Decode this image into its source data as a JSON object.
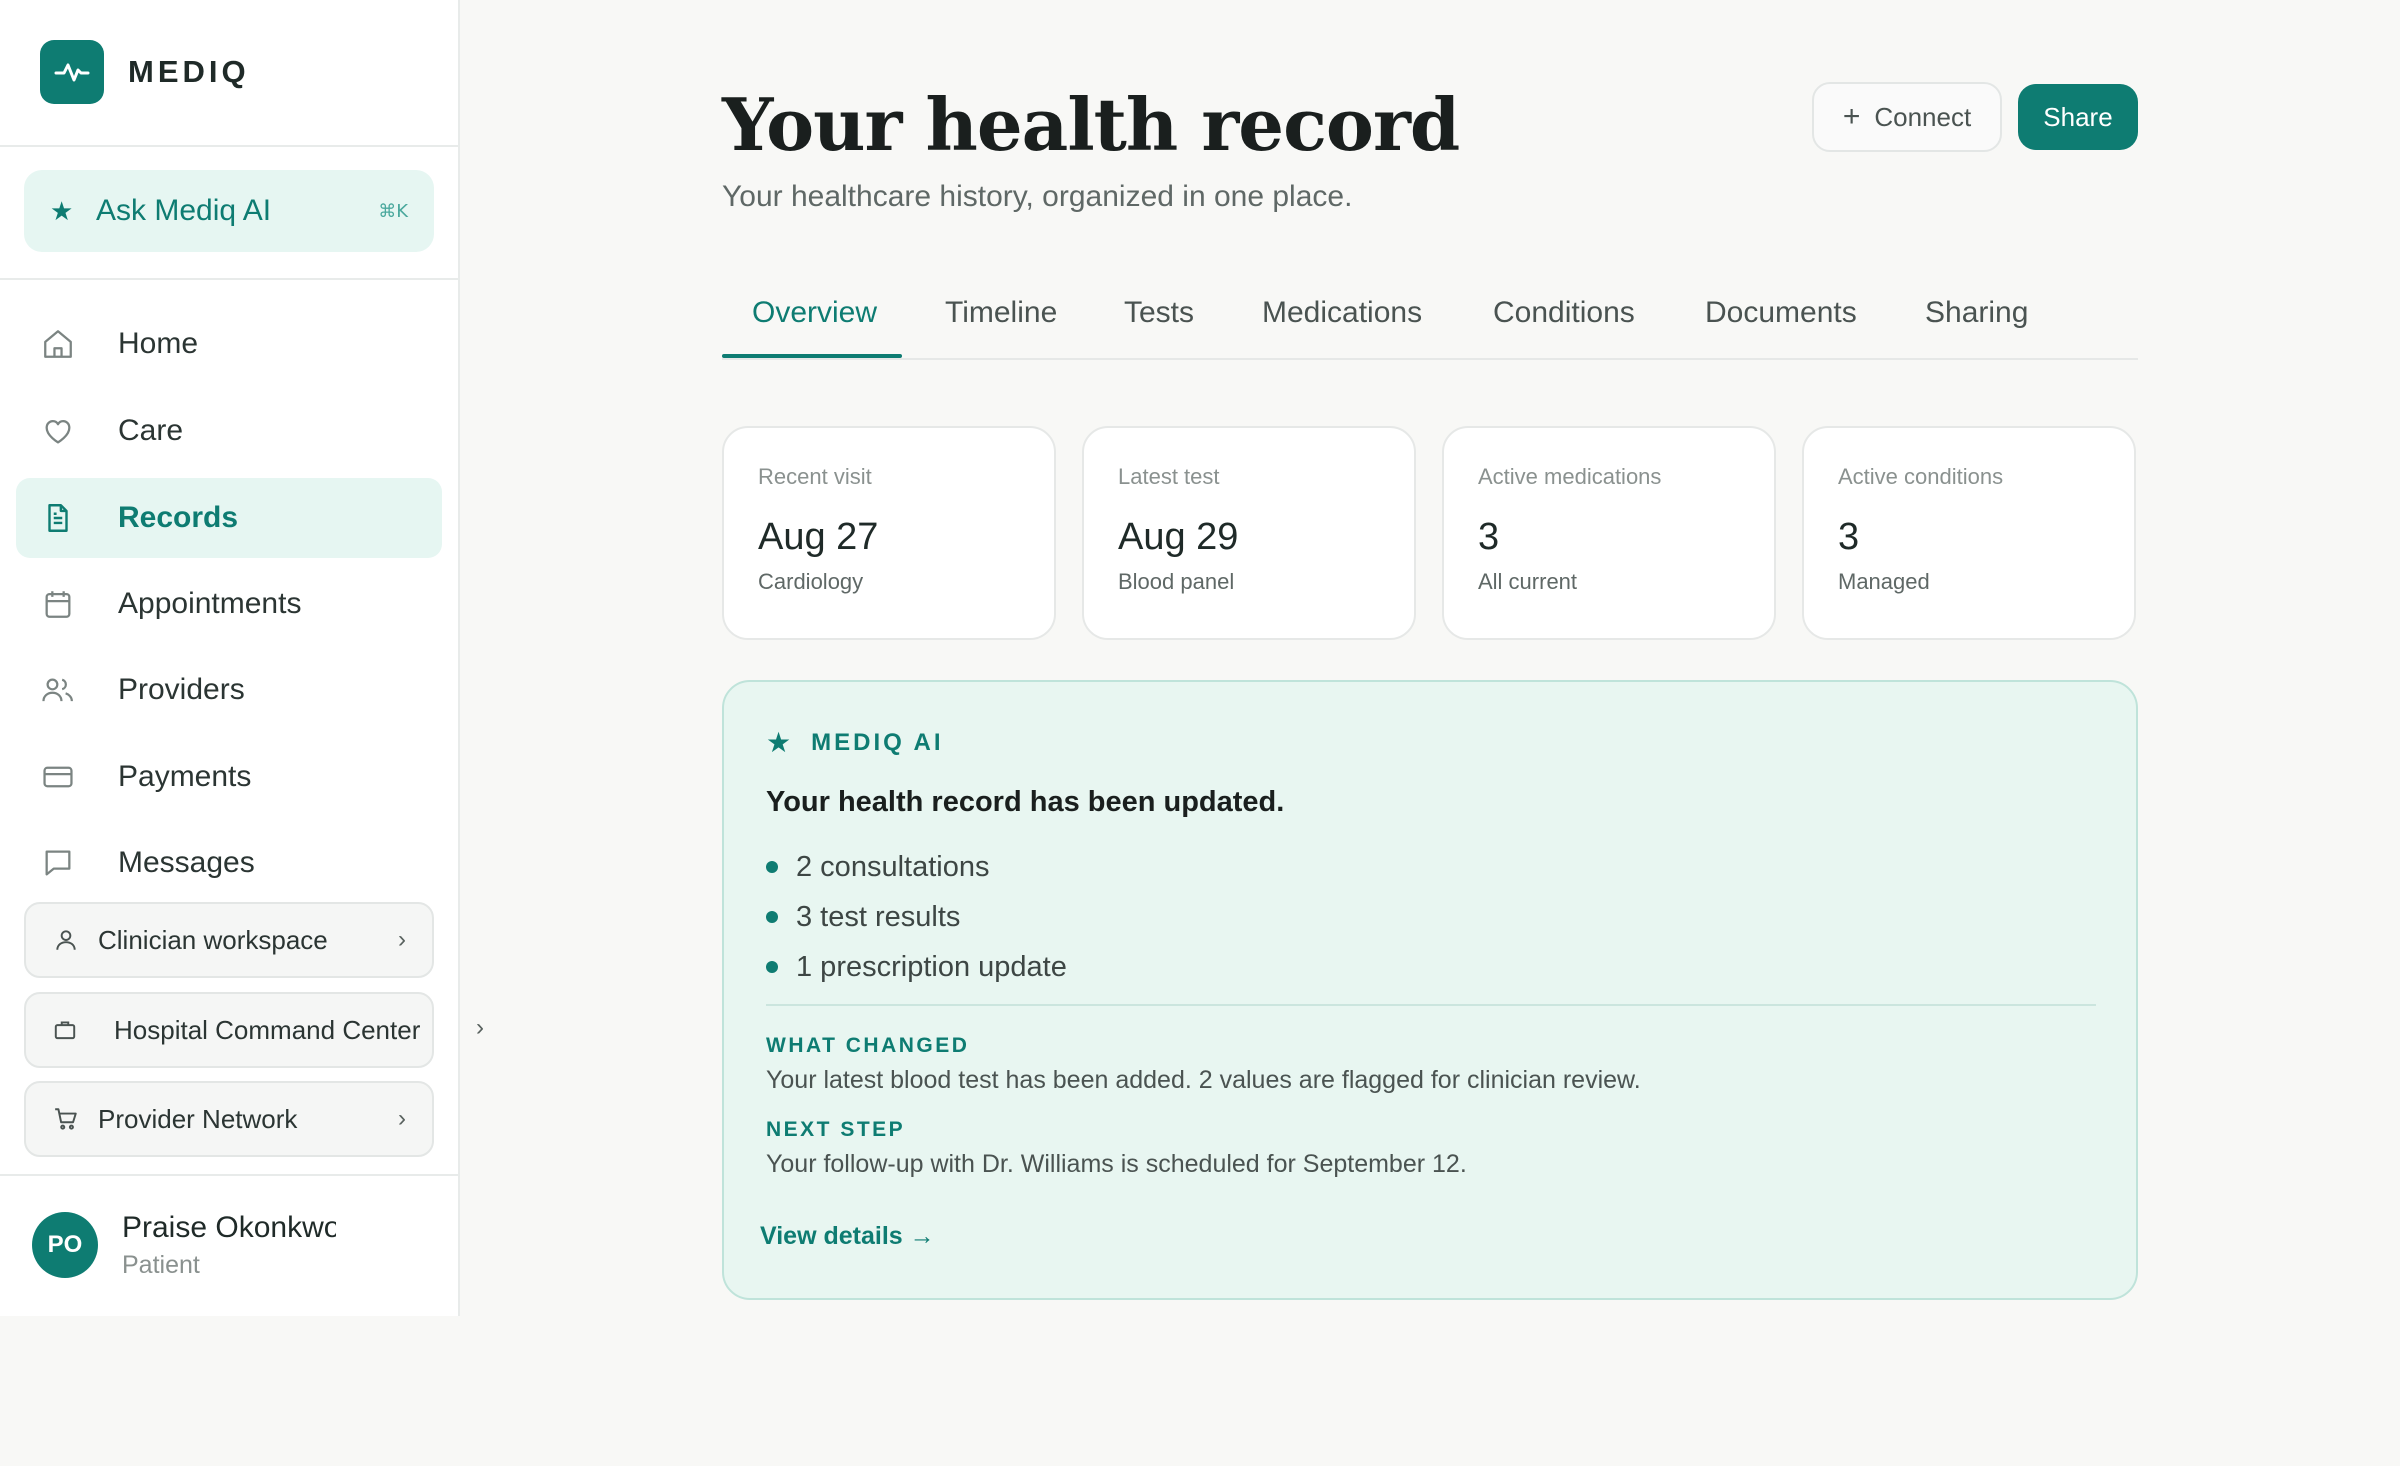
{
  "brand": {
    "name": "MEDIQ",
    "logo_icon": "pulse-icon"
  },
  "colors": {
    "accent": "#0e7c72",
    "accent_soft": "#e6f6f2"
  },
  "sidebar": {
    "ask_ai": {
      "label": "Ask Mediq AI",
      "shortcut": "⌘K",
      "icon": "star-icon"
    },
    "items": [
      {
        "label": "Home",
        "icon": "home-icon",
        "active": false
      },
      {
        "label": "Care",
        "icon": "heart-icon",
        "active": false
      },
      {
        "label": "Records",
        "icon": "document-icon",
        "active": true
      },
      {
        "label": "Appointments",
        "icon": "calendar-icon",
        "active": false
      },
      {
        "label": "Providers",
        "icon": "users-icon",
        "active": false
      },
      {
        "label": "Payments",
        "icon": "card-icon",
        "active": false
      },
      {
        "label": "Messages",
        "icon": "message-icon",
        "active": false
      }
    ],
    "workspaces": [
      {
        "label": "Clinician workspace",
        "icon": "person-icon"
      },
      {
        "label": "Hospital Command Center",
        "icon": "briefcase-icon"
      },
      {
        "label": "Provider Network",
        "icon": "cart-icon"
      }
    ],
    "user": {
      "initials": "PO",
      "name": "Praise Okonkwo",
      "role": "Patient"
    }
  },
  "header": {
    "title": "Your health record",
    "subtitle": "Your healthcare history, organized in one place.",
    "connect_label": "Connect",
    "share_label": "Share"
  },
  "tabs": [
    {
      "label": "Overview",
      "active": true
    },
    {
      "label": "Timeline",
      "active": false
    },
    {
      "label": "Tests",
      "active": false
    },
    {
      "label": "Medications",
      "active": false
    },
    {
      "label": "Conditions",
      "active": false
    },
    {
      "label": "Documents",
      "active": false
    },
    {
      "label": "Sharing",
      "active": false
    }
  ],
  "cards": [
    {
      "label": "Recent visit",
      "value": "Aug 27",
      "sub": "Cardiology"
    },
    {
      "label": "Latest test",
      "value": "Aug 29",
      "sub": "Blood panel"
    },
    {
      "label": "Active medications",
      "value": "3",
      "sub": "All current"
    },
    {
      "label": "Active conditions",
      "value": "3",
      "sub": "Managed"
    }
  ],
  "ai_panel": {
    "heading": "MEDIQ AI",
    "title": "Your health record has been updated.",
    "items": [
      "2 consultations",
      "3 test results",
      "1 prescription update"
    ],
    "what_changed_label": "WHAT CHANGED",
    "what_changed_text": "Your latest blood test has been added. 2 values are flagged for clinician review.",
    "next_step_label": "NEXT STEP",
    "next_step_text": "Your follow-up with Dr. Williams is scheduled for September 12.",
    "link_label": "View details →"
  }
}
